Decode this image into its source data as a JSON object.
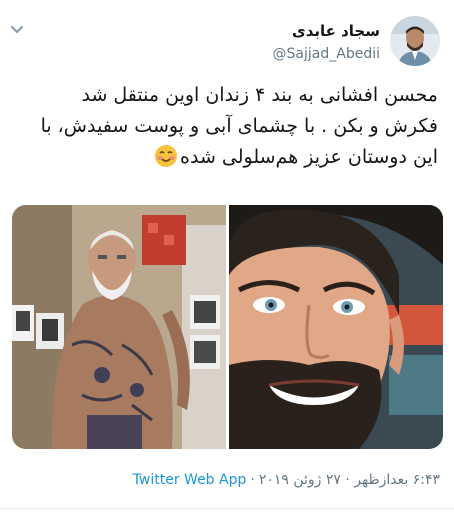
{
  "tweet": {
    "author_name": "سجاد عابدی",
    "handle": "@Sajjad_Abedii",
    "text_line_1": "محسن افشانی به بند ۴ زندان اوین منتقل شد",
    "text_line_2": "فکرش و بکن . با چشمای آبی و پوست سفیدش، با",
    "text_line_3": "این دوستان عزیز هم‌سلولی شده",
    "emoji_icon": "smiling-face-icon",
    "source": "Twitter Web App",
    "separator": "·",
    "timestamp": "۶:۴۳ بعدازظهر · ۲۷ ژوئن ۲۰۱۹"
  },
  "colors": {
    "link": "#1b95e0",
    "secondary": "#657786",
    "text": "#14171a"
  }
}
